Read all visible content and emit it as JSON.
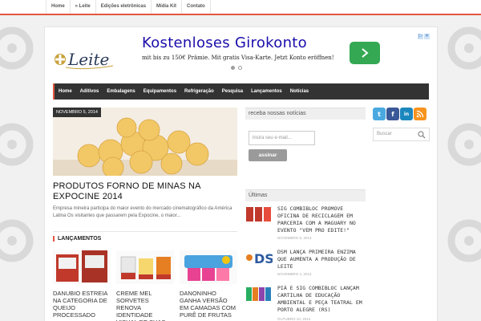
{
  "topnav": {
    "items": [
      "Home",
      "» Leite",
      "Edições eletrônicas",
      "Mídia Kit",
      "Contato"
    ]
  },
  "ad": {
    "title": "Kostenloses Girokonto",
    "text": "mit bis zu 150€ Prämie. Mit gratis Visa-Karte. Jetzt Konto eröffnen!"
  },
  "mainnav": {
    "items": [
      "Home",
      "Aditivos",
      "Embalagens",
      "Equipamentos",
      "Refrigeração",
      "Pesquisa",
      "Lançamentos",
      "Notícias"
    ]
  },
  "feature": {
    "date": "NOVEMBRO 5, 2014",
    "title": "PRODUTOS FORNO DE MINAS NA EXPOCINE 2014",
    "excerpt": "Empresa mineira participa do maior evento do mercado cinematográfico da América Latina Os visitantes que passarem pela Expocine, o maior..."
  },
  "launches": {
    "heading": "LANÇAMENTOS",
    "items": [
      {
        "title": "DANUBIO ESTREIA NA CATEGORIA DE QUEIJO PROCESSADO"
      },
      {
        "title": "CREME MEL SORVETES RENOVA IDENTIDADE VISUAL DE SUAS EMBALAGENS"
      },
      {
        "title": "DANONINHO GANHA VERSÃO EM CAMADAS COM PURÊ DE FRUTAS"
      }
    ]
  },
  "newsletter": {
    "heading": "receba nossas notícias",
    "placeholder": "insira seu e-mail...",
    "button": "assinar"
  },
  "latest": {
    "heading": "Últimas",
    "items": [
      {
        "title": "SIG COMBIBLOC PROMOVE OFICINA DE RECICLAGEM EM PARCERIA COM A MAGUARY NO EVENTO \"VEM PRO EDITE!\"",
        "date": "NOVEMBRO 5, 2014"
      },
      {
        "title": "DSM LANÇA PRIMEIRA ENZIMA QUE AUMENTA A PRODUÇÃO DE LEITE",
        "date": "NOVEMBRO 4, 2014"
      },
      {
        "title": "PIÁ E SIG COMBIBLOC LANÇAM CARTILHA DE EDUCAÇÃO AMBIENTAL E PEÇA TEATRAL EM PORTO ALEGRE (RS)",
        "date": "OUTUBRO 10, 2014"
      }
    ]
  },
  "sidebar": {
    "search_placeholder": "Buscar"
  },
  "colors": {
    "accent": "#e2583e",
    "nav_bg": "#333333",
    "ad_button": "#34a853"
  }
}
